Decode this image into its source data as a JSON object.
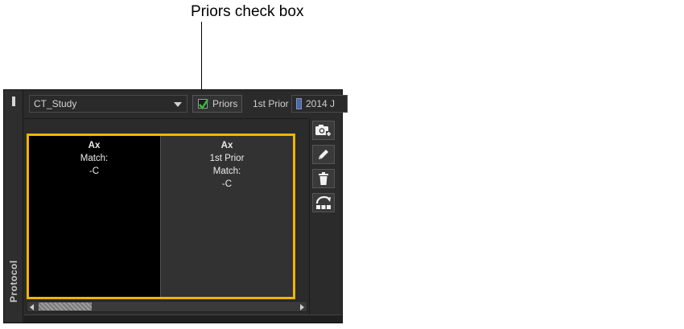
{
  "callout": {
    "text": "Priors check box"
  },
  "panel": {
    "rail_label": "Protocol",
    "study_select": {
      "value": "CT_Study"
    },
    "priors": {
      "label": "Priors",
      "checked": true
    },
    "prior_label": "1st Prior",
    "prior_date": "2014 J",
    "cells": [
      {
        "title": "Ax",
        "lines": [
          "Match:",
          "-C"
        ]
      },
      {
        "title": "Ax",
        "lines": [
          "1st Prior",
          "Match:",
          "-C"
        ]
      }
    ],
    "tools": [
      "camera-add-icon",
      "pencil-icon",
      "trash-icon",
      "rotate-layout-icon"
    ],
    "colors": {
      "highlight": "#f0b400",
      "checkmark": "#2fbf3a",
      "swatch": "#4b68a3"
    }
  }
}
